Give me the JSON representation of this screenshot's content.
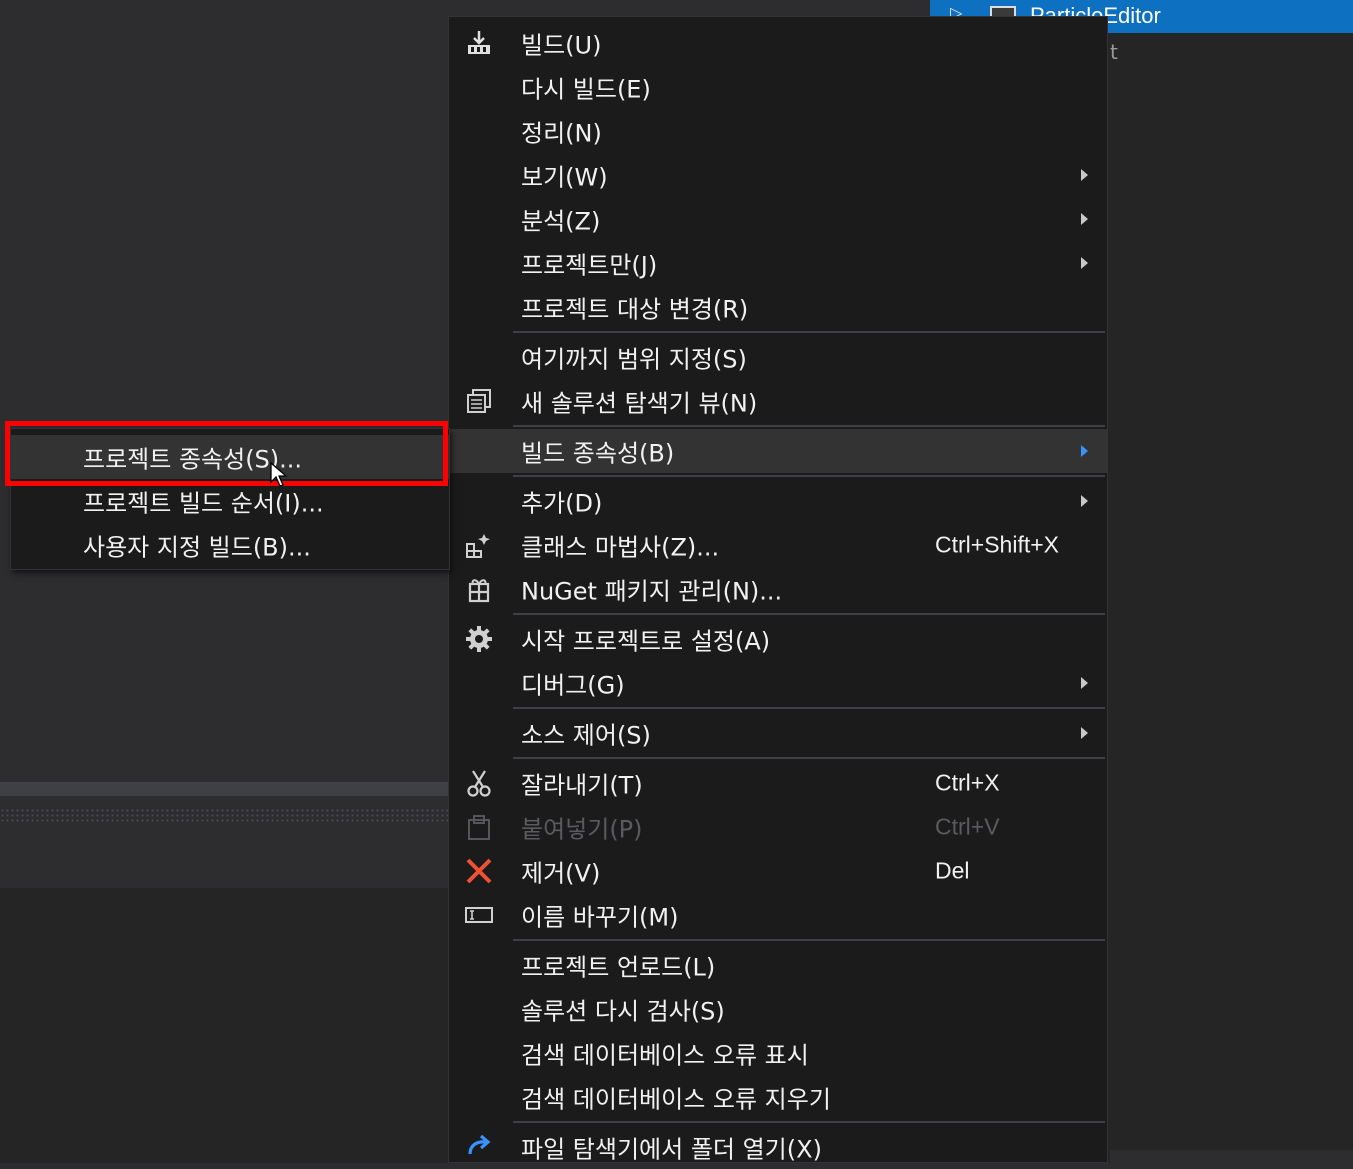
{
  "tree": {
    "project_name": "ParticleEditor",
    "sub_label": "t"
  },
  "context_menu": {
    "items": [
      {
        "label": "빌드(U)",
        "icon": "build-icon"
      },
      {
        "label": "다시 빌드(E)"
      },
      {
        "label": "정리(N)"
      },
      {
        "label": "보기(W)",
        "submenu": true
      },
      {
        "label": "분석(Z)",
        "submenu": true
      },
      {
        "label": "프로젝트만(J)",
        "submenu": true
      },
      {
        "label": "프로젝트 대상 변경(R)"
      },
      {
        "label": "여기까지 범위 지정(S)"
      },
      {
        "label": "새 솔루션 탐색기 뷰(N)",
        "icon": "new-view-icon"
      },
      {
        "label": "빌드 종속성(B)",
        "submenu": true,
        "highlighted": true
      },
      {
        "label": "추가(D)",
        "submenu": true
      },
      {
        "label": "클래스 마법사(Z)...",
        "shortcut": "Ctrl+Shift+X",
        "icon": "class-wizard-icon"
      },
      {
        "label": "NuGet 패키지 관리(N)...",
        "icon": "nuget-icon"
      },
      {
        "label": "시작 프로젝트로 설정(A)",
        "icon": "gear-icon"
      },
      {
        "label": "디버그(G)",
        "submenu": true
      },
      {
        "label": "소스 제어(S)",
        "submenu": true
      },
      {
        "label": "잘라내기(T)",
        "shortcut": "Ctrl+X",
        "icon": "scissors-icon"
      },
      {
        "label": "붙여넣기(P)",
        "shortcut": "Ctrl+V",
        "icon": "paste-icon",
        "disabled": true
      },
      {
        "label": "제거(V)",
        "shortcut": "Del",
        "icon": "remove-icon"
      },
      {
        "label": "이름 바꾸기(M)",
        "icon": "rename-icon"
      },
      {
        "label": "프로젝트 언로드(L)"
      },
      {
        "label": "솔루션 다시 검사(S)"
      },
      {
        "label": "검색 데이터베이스 오류 표시"
      },
      {
        "label": "검색 데이터베이스 오류 지우기"
      },
      {
        "label": "파일 탐색기에서 폴더 열기(X)",
        "icon": "open-folder-icon"
      }
    ]
  },
  "build_dependencies_submenu": {
    "items": [
      {
        "label": "프로젝트 종속성(S)...",
        "highlighted": true
      },
      {
        "label": "프로젝트 빌드 순서(I)..."
      },
      {
        "label": "사용자 지정 빌드(B)..."
      }
    ]
  },
  "colors": {
    "menu_bg": "#1b1b1c",
    "highlight_bg": "#333334",
    "selection_blue": "#0e70c0",
    "annotation_red": "#ff0000",
    "remove_icon_red": "#f05033",
    "accent_blue": "#3794ff"
  }
}
